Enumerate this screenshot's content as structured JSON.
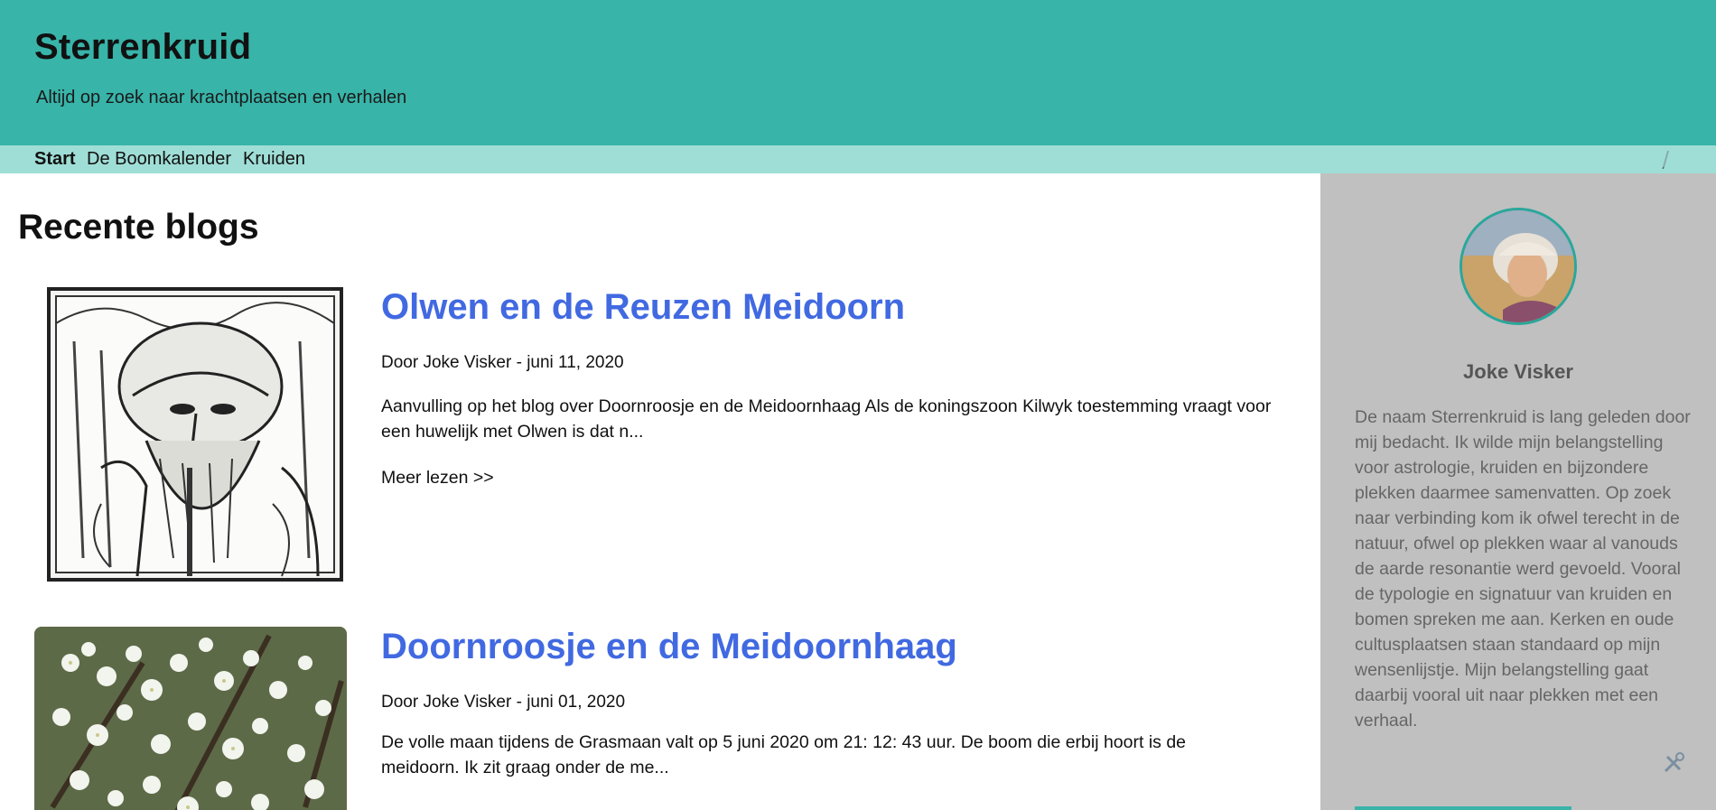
{
  "site": {
    "title": "Sterrenkruid",
    "tagline": "Altijd op zoek naar krachtplaatsen en verhalen"
  },
  "nav": {
    "items": [
      {
        "label": "Start",
        "active": true
      },
      {
        "label": "De Boomkalender",
        "active": false
      },
      {
        "label": "Kruiden",
        "active": false
      }
    ],
    "edit_icon": "pencil-icon"
  },
  "main": {
    "section_title": "Recente blogs",
    "posts": [
      {
        "title": "Olwen en de Reuzen Meidoorn",
        "meta": "Door Joke Visker - juni 11, 2020",
        "excerpt": "Aanvulling op het blog over Doornroosje en de Meidoornhaag Als de koningszoon Kilwyk toestemming vraagt voor een huwelijk met Olwen is dat n...",
        "more": "Meer lezen >>",
        "image": "woodcut-giant-illustration"
      },
      {
        "title": "Doornroosje en de Meidoornhaag",
        "meta": "Door Joke Visker - juni 01, 2020",
        "excerpt": "De volle maan tijdens de Grasmaan valt op 5 juni 2020 om 21: 12: 43 uur.   De boom die erbij hoort is de meidoorn.  Ik zit graag onder de me...",
        "image": "hawthorn-blossom-photo"
      }
    ]
  },
  "sidebar": {
    "author_name": "Joke Visker",
    "bio": "De naam Sterrenkruid is lang geleden door mij bedacht. Ik wilde mijn belangstelling voor astrologie, kruiden en bijzondere plekken daarmee samenvatten. Op zoek naar verbinding kom ik ofwel terecht in de natuur, ofwel op plekken waar al vanouds de aarde resonantie werd gevoeld. Vooral de typologie en signatuur van kruiden en bomen spreken me aan. Kerken en oude cultusplaatsen staan standaard op mijn wensenlijstje. Mijn belangstelling gaat daarbij vooral uit naar plekken met een verhaal.",
    "avatar": "author-avatar",
    "tools_icon": "tools-icon"
  },
  "colors": {
    "header": "#38b4a9",
    "nav": "#9fded6",
    "sidebar": "#c0c0c0",
    "link": "#4169e1"
  }
}
